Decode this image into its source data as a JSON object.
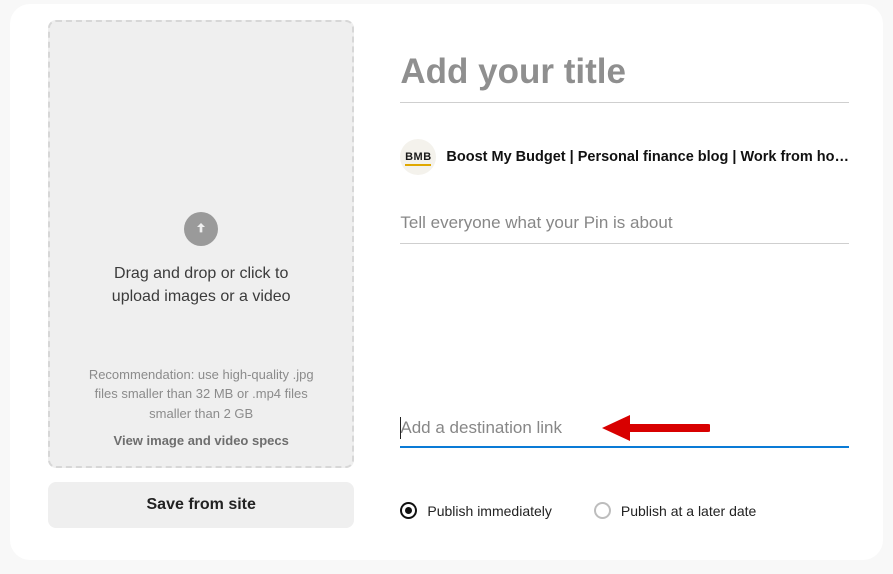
{
  "upload": {
    "primary_line1": "Drag and drop or click to",
    "primary_line2": "upload images or a video",
    "recommendation": "Recommendation: use high-quality .jpg files smaller than 32 MB or .mp4 files smaller than 2 GB",
    "specs_link": "View image and video specs",
    "save_from_site": "Save from site"
  },
  "profile": {
    "avatar_text": "BMB",
    "name": "Boost My Budget | Personal finance blog | Work from ho…"
  },
  "fields": {
    "title_placeholder": "Add your title",
    "description_placeholder": "Tell everyone what your Pin is about",
    "link_placeholder": "Add a destination link"
  },
  "publish": {
    "immediate": "Publish immediately",
    "later": "Publish at a later date"
  },
  "colors": {
    "link_focus": "#0a7bd6",
    "annotation_arrow": "#d80000"
  }
}
